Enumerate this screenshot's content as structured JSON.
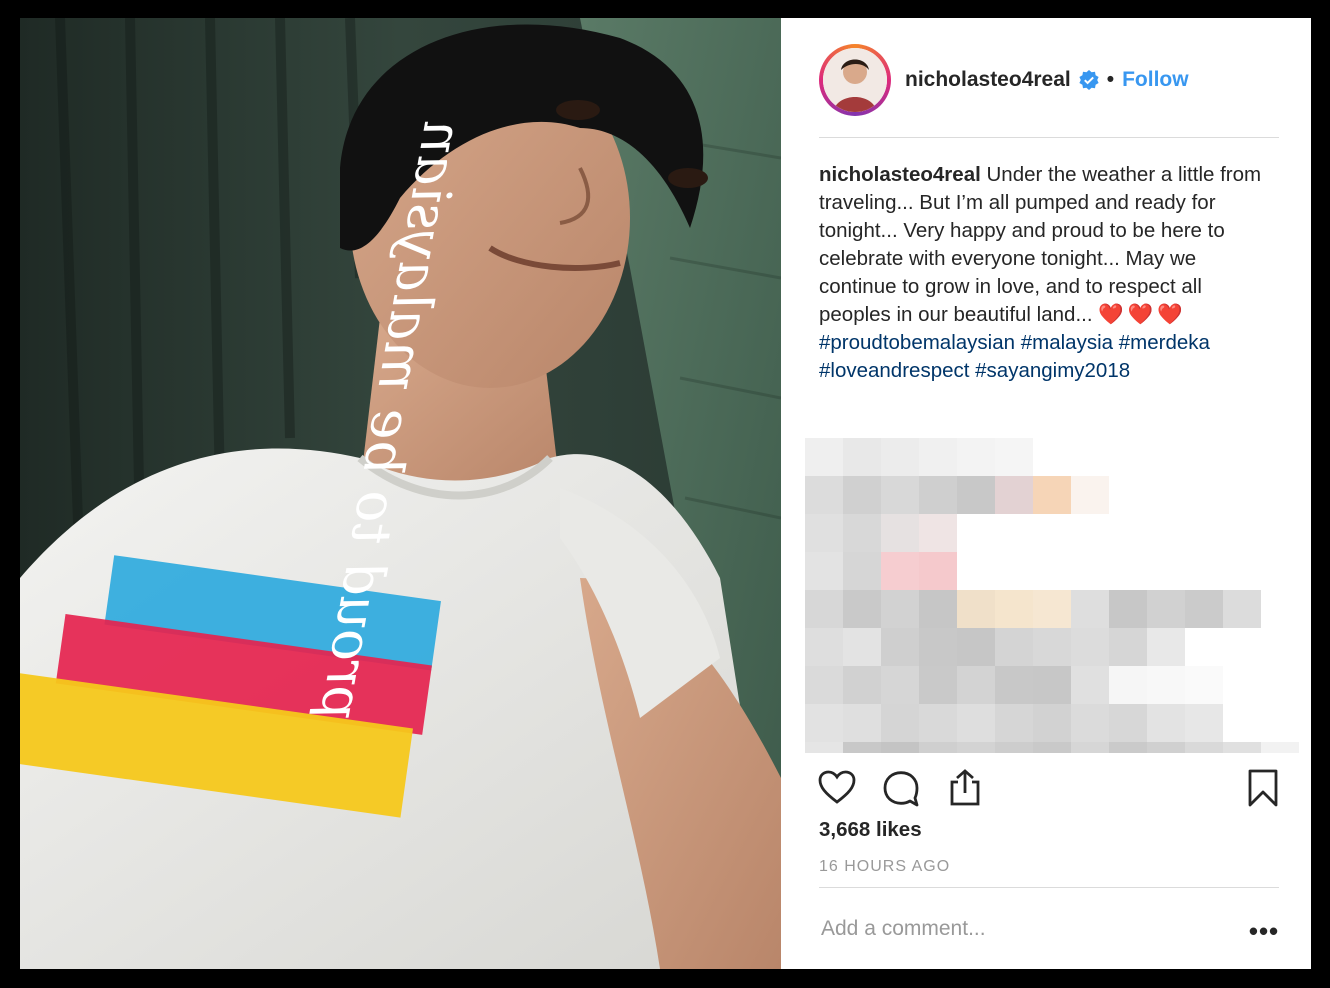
{
  "post": {
    "username": "nicholasteo4real",
    "separator": "•",
    "follow_label": "Follow",
    "caption": {
      "username": "nicholasteo4real",
      "text": "Under the weather a little from traveling... But I’m all pumped and ready for tonight... Very happy and proud to be here to celebrate with everyone tonight... May we continue to grow in love, and to respect all peoples in our beautiful land...",
      "hearts": "❤️❤️❤️",
      "hashtags": [
        "#proudtobemalaysian",
        "#malaysia",
        "#merdeka",
        "#loveandrespect",
        "#sayangimy2018"
      ]
    },
    "likes": "3,668 likes",
    "timestamp": "16 HOURS AGO",
    "comment_placeholder": "Add a comment...",
    "more_label": "•••"
  },
  "photo": {
    "shirt_text": "proud to be malaysian"
  },
  "icons": {
    "like": "heart-icon",
    "comment": "comment-icon",
    "share": "share-icon",
    "save": "bookmark-icon",
    "verified": "verified-badge-icon"
  },
  "colors": {
    "accent": "#3897f0",
    "hashtag": "#003569",
    "text": "#262626",
    "muted": "#999999",
    "divider": "#dbdbdb"
  }
}
